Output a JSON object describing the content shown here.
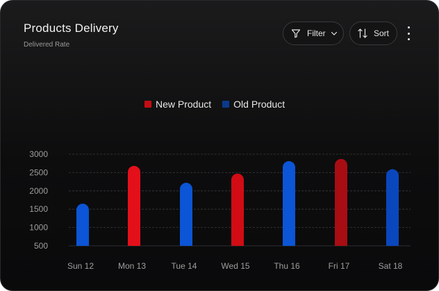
{
  "header": {
    "title": "Products Delivery",
    "subtitle": "Delivered Rate"
  },
  "toolbar": {
    "filter_label": "Filter",
    "sort_label": "Sort",
    "filter_icon": "funnel-icon",
    "sort_icon": "sort-arrows-icon",
    "more_icon": "more-vertical-icon"
  },
  "colors": {
    "new_product": "#c40d12",
    "old_product": "#0b3a8c",
    "bar_red": "#e3101a",
    "bar_blue": "#0b55d6",
    "grid": "#3a3a3c",
    "tick_text": "#9e9e9e"
  },
  "chart_data": {
    "type": "bar",
    "title": "Products Delivery",
    "subtitle": "Delivered Rate",
    "categories": [
      "Sun 12",
      "Mon 13",
      "Tue 14",
      "Wed 15",
      "Thu 16",
      "Fri 17",
      "Sat 18"
    ],
    "values": [
      1650,
      2680,
      2220,
      2470,
      2810,
      2870,
      2590
    ],
    "series_by_category": [
      "Old Product",
      "New Product",
      "Old Product",
      "New Product",
      "Old Product",
      "New Product",
      "Old Product"
    ],
    "legend": [
      {
        "name": "New Product",
        "color": "#c40d12"
      },
      {
        "name": "Old Product",
        "color": "#0b3a8c"
      }
    ],
    "legend_position": "top-center",
    "ylim": [
      500,
      3000
    ],
    "yticks": [
      3000,
      2500,
      2000,
      1500,
      1000,
      500
    ],
    "grid": true
  }
}
